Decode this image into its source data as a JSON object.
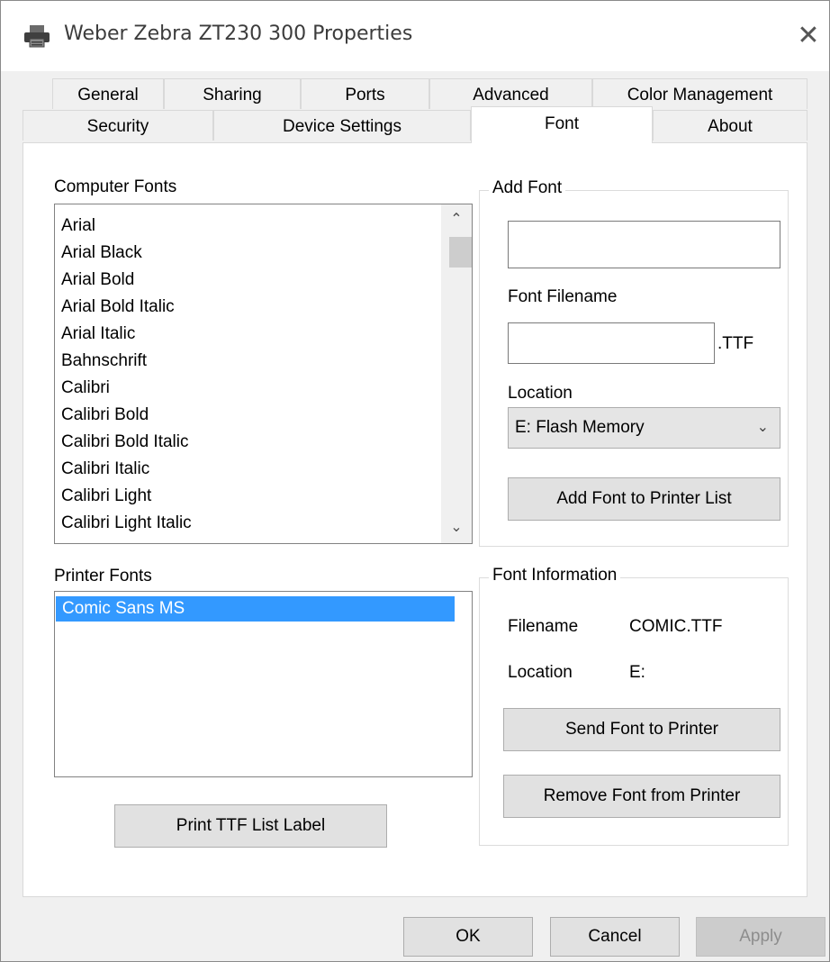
{
  "window": {
    "title": "Weber Zebra ZT230 300 Properties",
    "icon": "printer-icon",
    "close_glyph": "✕"
  },
  "tabs_row1": [
    "General",
    "Sharing",
    "Ports",
    "Advanced",
    "Color Management"
  ],
  "tabs_row2": [
    "Security",
    "Device Settings",
    "Font",
    "About"
  ],
  "active_tab": "Font",
  "computer_fonts": {
    "label": "Computer Fonts",
    "items": [
      "Arial",
      "Arial Black",
      "Arial Bold",
      "Arial Bold Italic",
      "Arial Italic",
      "Bahnschrift",
      "Calibri",
      "Calibri Bold",
      "Calibri Bold Italic",
      "Calibri Italic",
      "Calibri Light",
      "Calibri Light Italic"
    ]
  },
  "printer_fonts": {
    "label": "Printer Fonts",
    "items": [
      "Comic Sans MS"
    ],
    "selected_index": 0
  },
  "print_ttf_button": "Print TTF List Label",
  "add_font": {
    "group_label": "Add Font",
    "name_value": "",
    "filename_label": "Font Filename",
    "filename_value": "",
    "extension": ".TTF",
    "location_label": "Location",
    "location_value": "E: Flash Memory",
    "add_button": "Add Font to Printer List"
  },
  "font_info": {
    "group_label": "Font Information",
    "filename_label": "Filename",
    "filename_value": "COMIC.TTF",
    "location_label": "Location",
    "location_value": "E:",
    "send_button": "Send Font to Printer",
    "remove_button": "Remove Font from Printer"
  },
  "footer": {
    "ok": "OK",
    "cancel": "Cancel",
    "apply": "Apply"
  },
  "colors": {
    "selection": "#3399ff",
    "face": "#f0f0f0"
  }
}
